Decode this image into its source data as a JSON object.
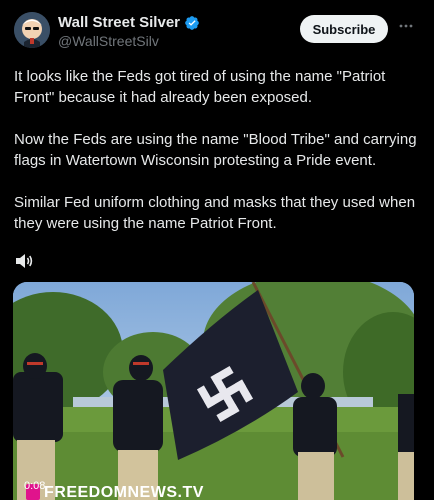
{
  "author": {
    "display_name": "Wall Street Silver",
    "handle": "@WallStreetSilv",
    "verified": true,
    "avatar_icon": "cartoon-man-avatar"
  },
  "actions": {
    "subscribe_label": "Subscribe",
    "more_icon": "more-horizontal-icon"
  },
  "post": {
    "paragraphs": [
      "It looks like the Feds got tired of using the name \"Patriot Front\" because it had already been exposed.",
      "Now the Feds are using the name \"Blood Tribe\" and carrying flags in Watertown Wisconsin protesting a Pride event.",
      "Similar Fed uniform clothing and masks that they used when they were using the name Patriot Front."
    ]
  },
  "media": {
    "sound_icon": "speaker-muted-icon",
    "timestamp": "0:08",
    "watermark": "FREEDOMNEWS.TV"
  },
  "colors": {
    "background": "#000000",
    "text": "#e7e9ea",
    "secondary_text": "#71767b",
    "verified": "#1d9bf0",
    "watermark_brand": "#e0138c"
  }
}
